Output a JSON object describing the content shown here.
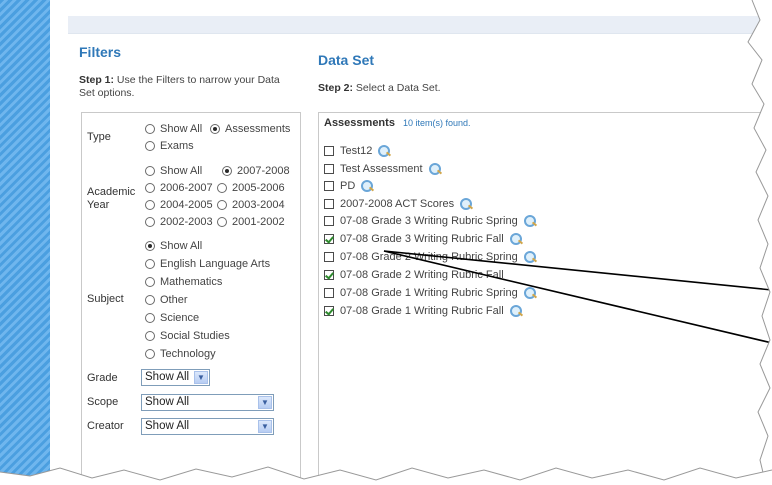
{
  "filters": {
    "heading": "Filters",
    "step_label": "Step 1:",
    "step_text": " Use the Filters to narrow your Data Set options.",
    "type": {
      "label": "Type",
      "options": [
        {
          "label": "Show All",
          "selected": false
        },
        {
          "label": "Assessments",
          "selected": true
        },
        {
          "label": "Exams",
          "selected": false
        }
      ]
    },
    "academic_year": {
      "label_line1": "Academic",
      "label_line2": "Year",
      "options": [
        {
          "label": "Show All",
          "selected": false
        },
        {
          "label": "2007-2008",
          "selected": true
        },
        {
          "label": "2006-2007",
          "selected": false
        },
        {
          "label": "2005-2006",
          "selected": false
        },
        {
          "label": "2004-2005",
          "selected": false
        },
        {
          "label": "2003-2004",
          "selected": false
        },
        {
          "label": "2002-2003",
          "selected": false
        },
        {
          "label": "2001-2002",
          "selected": false
        }
      ]
    },
    "subject": {
      "label": "Subject",
      "options": [
        {
          "label": "Show All",
          "selected": true
        },
        {
          "label": "English Language Arts",
          "selected": false
        },
        {
          "label": "Mathematics",
          "selected": false
        },
        {
          "label": "Other",
          "selected": false
        },
        {
          "label": "Science",
          "selected": false
        },
        {
          "label": "Social Studies",
          "selected": false
        },
        {
          "label": "Technology",
          "selected": false
        }
      ]
    },
    "grade": {
      "label": "Grade",
      "value": "Show All"
    },
    "scope": {
      "label": "Scope",
      "value": "Show All"
    },
    "creator": {
      "label": "Creator",
      "value": "Show All"
    }
  },
  "dataset": {
    "heading": "Data Set",
    "step_label": "Step 2:",
    "step_text": "  Select a Data Set.",
    "list_title": "Assessments",
    "count_text": "10 item(s) found.",
    "items": [
      {
        "label": "Test12",
        "checked": false
      },
      {
        "label": "Test Assessment",
        "checked": false
      },
      {
        "label": "PD",
        "checked": false
      },
      {
        "label": "2007-2008 ACT Scores",
        "checked": false
      },
      {
        "label": "07-08 Grade 3 Writing Rubric Spring",
        "checked": false
      },
      {
        "label": "07-08 Grade 3 Writing Rubric Fall",
        "checked": true
      },
      {
        "label": "07-08 Grade 2 Writing Rubric Spring",
        "checked": false
      },
      {
        "label": "07-08 Grade 2 Writing Rubric Fall",
        "checked": true
      },
      {
        "label": "07-08 Grade 1 Writing Rubric Spring",
        "checked": false
      },
      {
        "label": "07-08 Grade 1 Writing Rubric Fall",
        "checked": true
      }
    ]
  },
  "icons": {
    "radio": "radio-button-icon",
    "checkbox": "checkbox-icon",
    "magnifier": "magnifier-icon",
    "dropdown": "chevron-down-icon"
  },
  "colors": {
    "accent": "#2f78b8",
    "stripe": "#4b9fe0",
    "border": "#c9c9c9"
  }
}
